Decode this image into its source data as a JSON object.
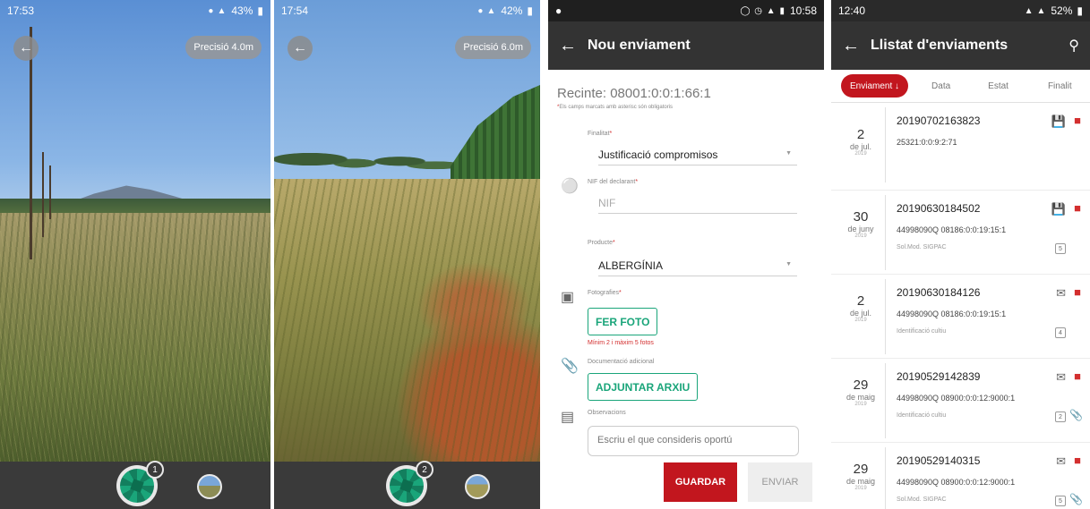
{
  "screens": {
    "camera1": {
      "status": {
        "time": "17:53",
        "battery": "43%"
      },
      "precision": "Precisió 4.0m",
      "photo_count": "1"
    },
    "camera2": {
      "status": {
        "time": "17:54",
        "battery": "42%"
      },
      "precision": "Precisió 6.0m",
      "photo_count": "2"
    },
    "form": {
      "status": {
        "time": "10:58"
      },
      "title": "Nou enviament",
      "recinte": "Recinte: 08001:0:0:1:66:1",
      "required_note": "Els camps marcats amb asterisc són obligatoris",
      "finalitat": {
        "label": "Finalitat",
        "value": "Justificació compromisos"
      },
      "nif": {
        "label": "NIF del declarant",
        "placeholder": "NIF"
      },
      "producte": {
        "label": "Producte",
        "value": "ALBERGÍNIA"
      },
      "fotografies": {
        "label": "Fotografies",
        "button": "FER FOTO",
        "hint": "Mínim 2 i màxim 5 fotos"
      },
      "documentacio": {
        "label": "Documentació adicional",
        "button": "ADJUNTAR ARXIU"
      },
      "observacions": {
        "label": "Observacions",
        "placeholder": "Escriu el que consideris oportú"
      },
      "guardar": "GUARDAR",
      "enviar": "ENVIAR"
    },
    "list": {
      "status": {
        "time": "12:40",
        "battery": "52%"
      },
      "title": "Llistat d'enviaments",
      "tabs": [
        "Enviament",
        "Data",
        "Estat",
        "Finalit"
      ],
      "items": [
        {
          "day": "2",
          "month": "de jul.",
          "year": "2019",
          "id": "20190702163823",
          "line2": "25321:0:0:9:2:71",
          "type": "",
          "badge": "",
          "icons": [
            "save-icon",
            "delete-icon"
          ]
        },
        {
          "day": "30",
          "month": "de juny",
          "year": "2019",
          "id": "20190630184502",
          "line2": "44998090Q  08186:0:0:19:15:1",
          "type": "Sol.Mod. SIGPAC",
          "badge": "5",
          "icons": [
            "save-icon",
            "delete-icon"
          ]
        },
        {
          "day": "2",
          "month": "de jul.",
          "year": "2019",
          "id": "20190630184126",
          "line2": "44998090Q  08186:0:0:19:15:1",
          "type": "Identificació cultiu",
          "badge": "4",
          "icons": [
            "mail-icon",
            "delete-icon"
          ]
        },
        {
          "day": "29",
          "month": "de maig",
          "year": "2019",
          "id": "20190529142839",
          "line2": "44998090Q  08900:0:0:12:9000:1",
          "type": "Identificació cultiu",
          "badge": "2",
          "icons": [
            "mail-icon",
            "delete-icon"
          ]
        },
        {
          "day": "29",
          "month": "de maig",
          "year": "2019",
          "id": "20190529140315",
          "line2": "44998090Q  08900:0:0:12:9000:1",
          "type": "Sol.Mod. SIGPAC",
          "badge": "5",
          "icons": [
            "mail-icon",
            "delete-icon"
          ]
        }
      ]
    }
  },
  "colors": {
    "accent_red": "#c2161e",
    "accent_green": "#1aa57a",
    "appbar": "#333333"
  }
}
